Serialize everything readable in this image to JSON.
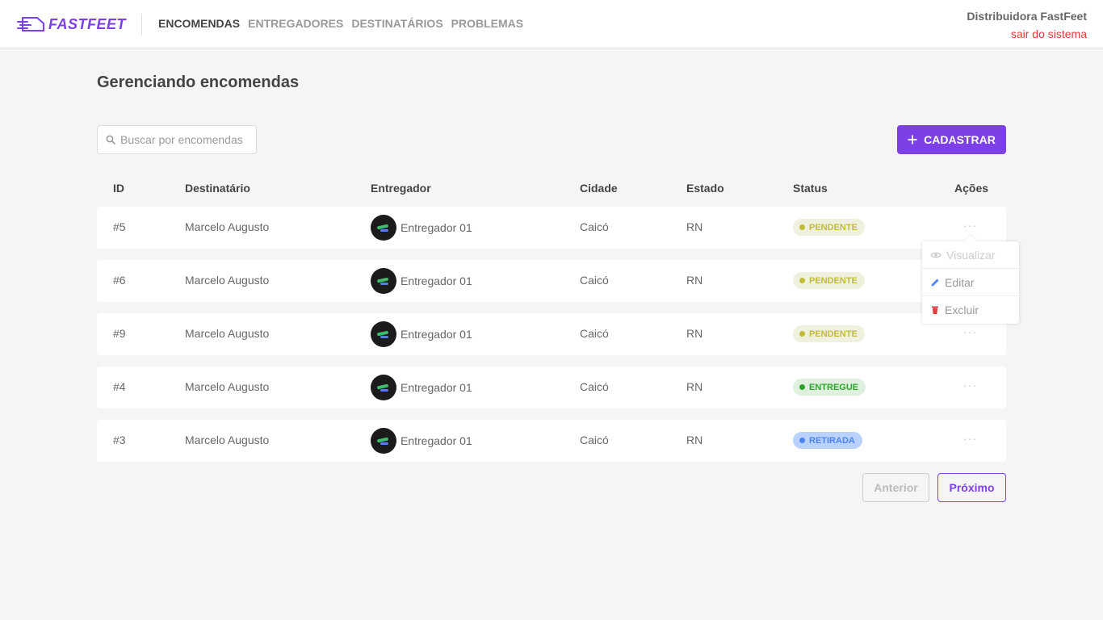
{
  "header": {
    "logo_text": "FASTFEET",
    "nav": [
      "ENCOMENDAS",
      "ENTREGADORES",
      "DESTINATÁRIOS",
      "PROBLEMAS"
    ],
    "active_nav": "ENCOMENDAS",
    "user_name": "Distribuidora FastFeet",
    "logout_label": "sair do sistema"
  },
  "main": {
    "title": "Gerenciando encomendas",
    "search_placeholder": "Buscar por encomendas",
    "search_value": "",
    "register_label": "CADASTRAR",
    "columns": [
      "ID",
      "Destinatário",
      "Entregador",
      "Cidade",
      "Estado",
      "Status",
      "Ações"
    ],
    "rows": [
      {
        "id": "#5",
        "recipient": "Marcelo Augusto",
        "deliveryman": "Entregador 01",
        "city": "Caicó",
        "state": "RN",
        "status": "PENDENTE",
        "status_key": "pending",
        "actions": "···"
      },
      {
        "id": "#6",
        "recipient": "Marcelo Augusto",
        "deliveryman": "Entregador 01",
        "city": "Caicó",
        "state": "RN",
        "status": "PENDENTE",
        "status_key": "pending",
        "actions": "···"
      },
      {
        "id": "#9",
        "recipient": "Marcelo Augusto",
        "deliveryman": "Entregador 01",
        "city": "Caicó",
        "state": "RN",
        "status": "PENDENTE",
        "status_key": "pending",
        "actions": "···"
      },
      {
        "id": "#4",
        "recipient": "Marcelo Augusto",
        "deliveryman": "Entregador 01",
        "city": "Caicó",
        "state": "RN",
        "status": "ENTREGUE",
        "status_key": "delivered",
        "actions": "···"
      },
      {
        "id": "#3",
        "recipient": "Marcelo Augusto",
        "deliveryman": "Entregador 01",
        "city": "Caicó",
        "state": "RN",
        "status": "RETIRADA",
        "status_key": "withdrawn",
        "actions": "···"
      }
    ],
    "actions_menu": {
      "view_label": "Visualizar",
      "edit_label": "Editar",
      "delete_label": "Excluir"
    },
    "pagination": {
      "prev_label": "Anterior",
      "next_label": "Próximo"
    }
  },
  "colors": {
    "accent": "#7d40e7",
    "logout": "#de3b3b",
    "pending_bg": "#f0f0df",
    "pending_fg": "#c1bc35",
    "delivered_bg": "#dff0df",
    "delivered_fg": "#2ca42b",
    "withdrawn_bg": "#bad2ff",
    "withdrawn_fg": "#4d85ee"
  },
  "icons": {
    "logo": "fast-truck-icon",
    "search": "search-icon",
    "register": "plus-icon",
    "row_avatar": "avatar",
    "view": "eye-icon",
    "edit": "pencil-icon",
    "delete": "trash-icon"
  }
}
